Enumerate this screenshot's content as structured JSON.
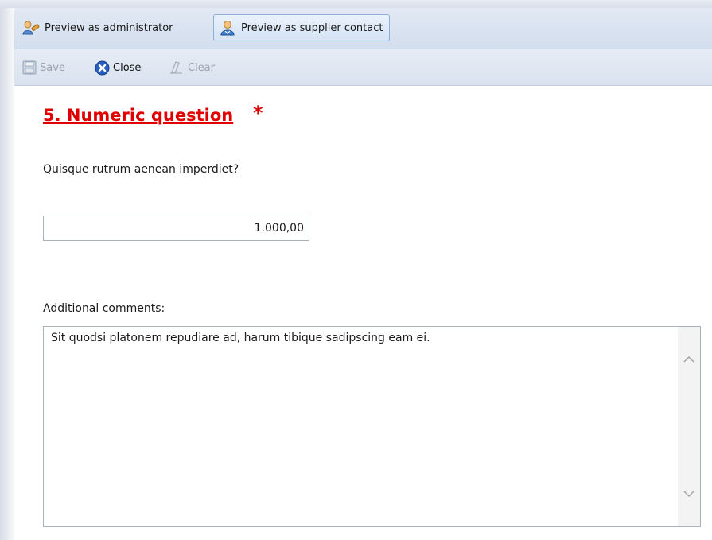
{
  "preview_toolbar": {
    "admin_label": "Preview as administrator",
    "supplier_label": "Preview as supplier contact"
  },
  "action_toolbar": {
    "save_label": "Save",
    "close_label": "Close",
    "clear_label": "Clear"
  },
  "question": {
    "title": "5. Numeric question",
    "required_marker": "*",
    "text": "Quisque rutrum aenean imperdiet?",
    "answer_value": "1.000,00"
  },
  "comments": {
    "label": "Additional comments:",
    "value": "Sit quodsi platonem repudiare ad, harum tibique sadipscing eam ei."
  },
  "icons": {
    "admin": "admin-user-icon",
    "supplier": "supplier-user-icon",
    "save": "save-icon",
    "close": "close-icon",
    "clear": "eraser-icon"
  },
  "colors": {
    "title_red": "#e00000",
    "toolbar_blue": "#d3deee",
    "close_blue": "#2a5fc1"
  }
}
